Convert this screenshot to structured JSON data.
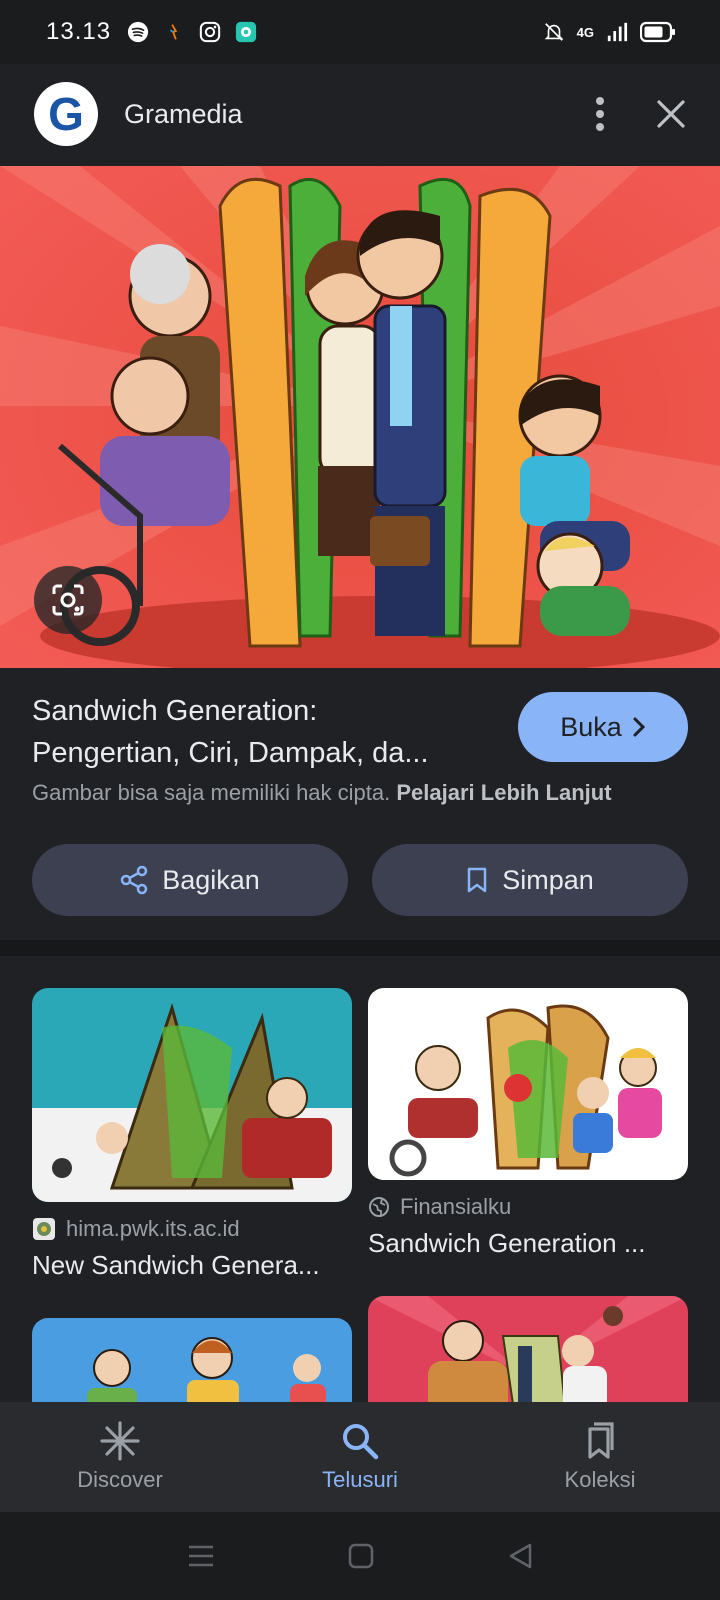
{
  "status_bar": {
    "time": "13.13",
    "network": "4G"
  },
  "header": {
    "logo_letter": "G",
    "site_name": "Gramedia"
  },
  "result": {
    "title_line1": "Sandwich Generation:",
    "title_line2": "Pengertian, Ciri, Dampak, da...",
    "open_label": "Buka",
    "copyright_text": "Gambar bisa saja memiliki hak cipta.",
    "learn_more": "Pelajari Lebih Lanjut",
    "share_label": "Bagikan",
    "save_label": "Simpan"
  },
  "related": [
    {
      "source": "hima.pwk.its.ac.id",
      "title": "New Sandwich Genera..."
    },
    {
      "source": "Finansialku",
      "title": "Sandwich Generation ..."
    }
  ],
  "bottom_nav": {
    "discover": "Discover",
    "search": "Telusuri",
    "collections": "Koleksi"
  },
  "colors": {
    "accent": "#8ab4f8",
    "background": "#202124"
  }
}
